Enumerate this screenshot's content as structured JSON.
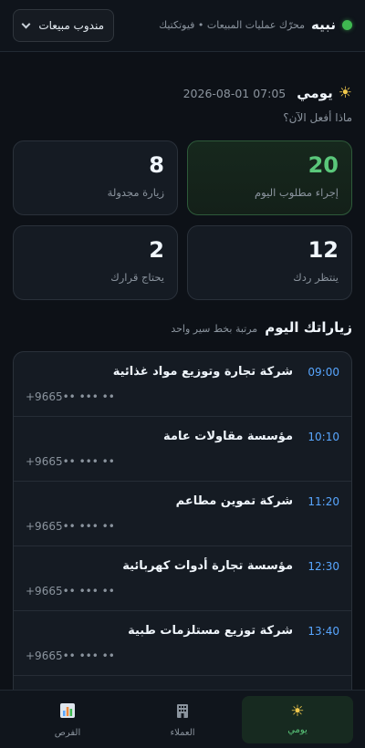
{
  "header": {
    "brand_name": "نبيه",
    "tagline": "محرّك عمليات المبيعات • فيوتكتيك",
    "role_label": "مندوب مبيعات"
  },
  "day": {
    "title": "يومي",
    "date": "2026-08-01 07:05",
    "question": "ماذا أفعل الآن؟"
  },
  "stats": [
    {
      "value": "20",
      "label": "إجراء مطلوب اليوم"
    },
    {
      "value": "8",
      "label": "زيارة مجدولة"
    },
    {
      "value": "12",
      "label": "ينتظر ردك"
    },
    {
      "value": "2",
      "label": "يحتاج قرارك"
    }
  ],
  "visits_section": {
    "title": "زياراتك اليوم",
    "subtitle": "مرتبة بخط سير واحد"
  },
  "visits": [
    {
      "time": "09:00",
      "company": "شركة تجارة وتوزيع مواد غذائية",
      "phone": "+9665•• ••• ••"
    },
    {
      "time": "10:10",
      "company": "مؤسسة مقاولات عامة",
      "phone": "+9665•• ••• ••"
    },
    {
      "time": "11:20",
      "company": "شركة تموين مطاعم",
      "phone": "+9665•• ••• ••"
    },
    {
      "time": "12:30",
      "company": "مؤسسة تجارة أدوات كهربائية",
      "phone": "+9665•• ••• ••"
    },
    {
      "time": "13:40",
      "company": "شركة توزيع مستلزمات طبية",
      "phone": "+9665•• ••• ••"
    }
  ],
  "nav": [
    {
      "label": "يومي",
      "icon": "sun-icon"
    },
    {
      "label": "العملاء",
      "icon": "building-icon"
    },
    {
      "label": "الفرص",
      "icon": "chart-icon"
    }
  ],
  "colors": {
    "accent_green": "#5ac77a",
    "accent_blue": "#58a6ff",
    "background": "#0d1117"
  }
}
